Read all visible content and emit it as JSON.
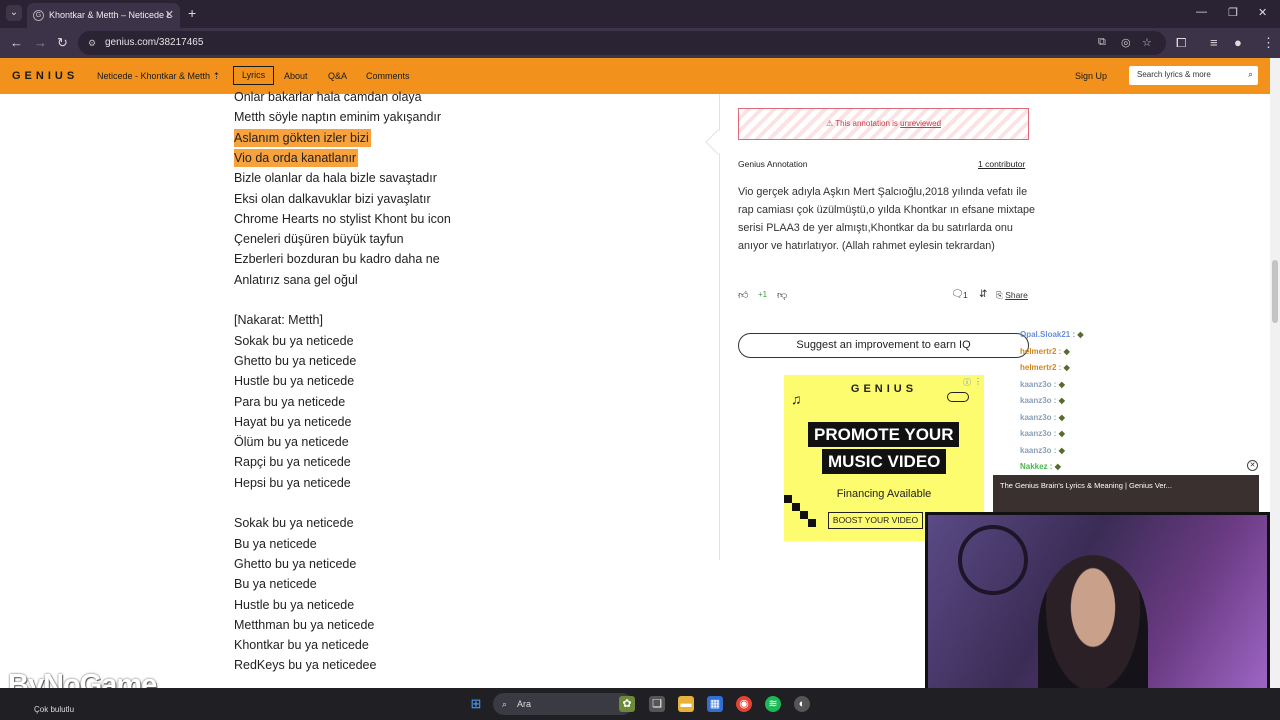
{
  "browser": {
    "tab_title": "Khontkar & Metth – Neticede L",
    "url": "genius.com/38217465"
  },
  "header": {
    "logo": "GENIUS",
    "song": "Neticede - Khontkar & Metth",
    "nav": [
      "Lyrics",
      "About",
      "Q&A",
      "Comments"
    ],
    "sign_up": "Sign Up",
    "search_placeholder": "Search lyrics & more"
  },
  "lyrics": [
    "Onlar bakarlar hala camdan olaya",
    "Metth söyle naptın eminim yakışandır",
    "Aslanım gökten izler bizi",
    "Vio da orda kanatlanır",
    "Bizle olanlar da hala bizle savaştadır",
    "Eksi olan dalkavuklar bizi yavaşlatır",
    "Chrome Hearts no stylist Khont bu icon",
    "Çeneleri düşüren büyük tayfun",
    "Ezberleri bozduran bu kadro daha ne",
    "Anlatırız sana gel oğul",
    "",
    "[Nakarat: Metth]",
    "Sokak bu ya neticede",
    "Ghetto bu ya neticede",
    "Hustle bu ya neticede",
    "Para bu ya neticede",
    "Hayat bu ya neticede",
    "Ölüm bu ya neticede",
    "Rapçi bu ya neticede",
    "Hepsi bu ya neticede",
    "",
    "Sokak bu ya neticede",
    "Bu ya neticede",
    "Ghetto bu ya neticede",
    "Bu ya neticede",
    "Hustle bu ya neticede",
    "Metthman bu ya neticede",
    "Khontkar bu ya neticede",
    "RedKeys bu ya neticedee"
  ],
  "annotation": {
    "warning_prefix": "This annotation is",
    "warning_link": "unreviewed",
    "label": "Genius Annotation",
    "contributors": "1 contributor",
    "body": "Vio gerçek adıyla Aşkın Mert Şalcıoğlu,2018 yılında vefatı ile rap camiası çok üzülmüştü,o yılda Khontkar ın efsane mixtape serisi PLAA3 de yer almıştı,Khontkar da bu satırlarda onu anıyor ve hatırlatıyor. (Allah rahmet eylesin tekrardan)",
    "vote_count": "+1",
    "comment_count": "1",
    "share": "Share",
    "suggest": "Suggest an improvement to earn IQ"
  },
  "ad": {
    "logo": "GENIUS",
    "line1": "PROMOTE YOUR",
    "line2": "MUSIC VIDEO",
    "sub": "Financing Available",
    "cta": "BOOST YOUR VIDEO"
  },
  "chat": [
    {
      "user": "Opal.Sloak21 :",
      "color": "#6a8fd8"
    },
    {
      "user": "helmertr2 :",
      "color": "#d2871b"
    },
    {
      "user": "helmertr2 :",
      "color": "#d2871b"
    },
    {
      "user": "kaanz3o :",
      "color": "#8aa0b6"
    },
    {
      "user": "kaanz3o :",
      "color": "#8aa0b6"
    },
    {
      "user": "kaanz3o :",
      "color": "#8aa0b6"
    },
    {
      "user": "kaanz3o :",
      "color": "#8aa0b6"
    },
    {
      "user": "kaanz3o :",
      "color": "#8aa0b6"
    },
    {
      "user": "Nakkez :",
      "color": "#47b84a"
    }
  ],
  "mini_player": {
    "title": "The Genius Brain's Lyrics & Meaning | Genius Ver..."
  },
  "watermark": "ByNoGame",
  "taskbar": {
    "search": "Ara",
    "weather": "Çok bulutlu"
  },
  "colors": {
    "genius_orange": "#f2921c",
    "highlight": "#f7a23c",
    "ad_yellow": "#fdfb6e"
  }
}
